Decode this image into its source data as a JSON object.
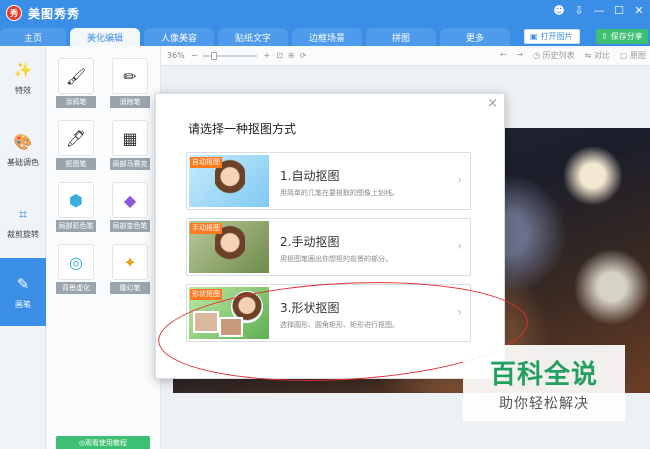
{
  "app": {
    "title": "美图秀秀",
    "logo_text": "秀"
  },
  "window_controls": [
    "☻",
    "⇩",
    "—",
    "☐",
    "✕"
  ],
  "tabs": [
    {
      "label": "主页"
    },
    {
      "label": "美化编辑",
      "active": true
    },
    {
      "label": "人像美容"
    },
    {
      "label": "贴纸文字"
    },
    {
      "label": "边框场景"
    },
    {
      "label": "拼图"
    },
    {
      "label": "更多"
    }
  ],
  "header_buttons": {
    "open": "打开图片",
    "save": "保存分享"
  },
  "sidebar": {
    "items": [
      {
        "label": "特效",
        "icon": "magic-wand-icon",
        "glyph": "✨"
      },
      {
        "label": "基础调色",
        "icon": "palette-icon",
        "glyph": "🎨"
      },
      {
        "label": "裁剪旋转",
        "icon": "crop-icon",
        "glyph": "⌗"
      },
      {
        "label": "画笔",
        "icon": "brush-icon",
        "glyph": "✎",
        "active": true
      }
    ]
  },
  "tools": [
    {
      "label": "涂鸦笔",
      "glyph": "🖌"
    },
    {
      "label": "消除笔",
      "glyph": "✏"
    },
    {
      "label": "抠图笔",
      "glyph": "🖊"
    },
    {
      "label": "局部马赛克",
      "glyph": "▦"
    },
    {
      "label": "局部彩色笔",
      "glyph": "⬢"
    },
    {
      "label": "局部变色笔",
      "glyph": "◆"
    },
    {
      "label": "背景虚化",
      "glyph": "◎"
    },
    {
      "label": "魔幻笔",
      "glyph": "✦"
    }
  ],
  "tutorial_button": "◎观看使用教程",
  "toolbar": {
    "zoom": "36%",
    "minus": "−",
    "plus": "+",
    "icons": "⊡⊕⟳",
    "undo": "←",
    "redo": "→",
    "history": "历史列表",
    "compare": "对比",
    "original": "原图"
  },
  "dialog": {
    "title": "请选择一种抠图方式",
    "close": "×",
    "options": [
      {
        "tag": "自动抠图",
        "title": "1.自动抠图",
        "desc": "用简单的几笔在要抠取的图像上划线。"
      },
      {
        "tag": "手动抠图",
        "title": "2.手动抠图",
        "desc": "用抠图笔圈出你想抠的前景的部分。"
      },
      {
        "tag": "形状抠图",
        "title": "3.形状抠图",
        "desc": "选择圆形、圆角矩形、矩形进行抠图。"
      }
    ],
    "arrow": "›"
  },
  "watermark": {
    "main": "百科全说",
    "sub": "助你轻松解决"
  }
}
